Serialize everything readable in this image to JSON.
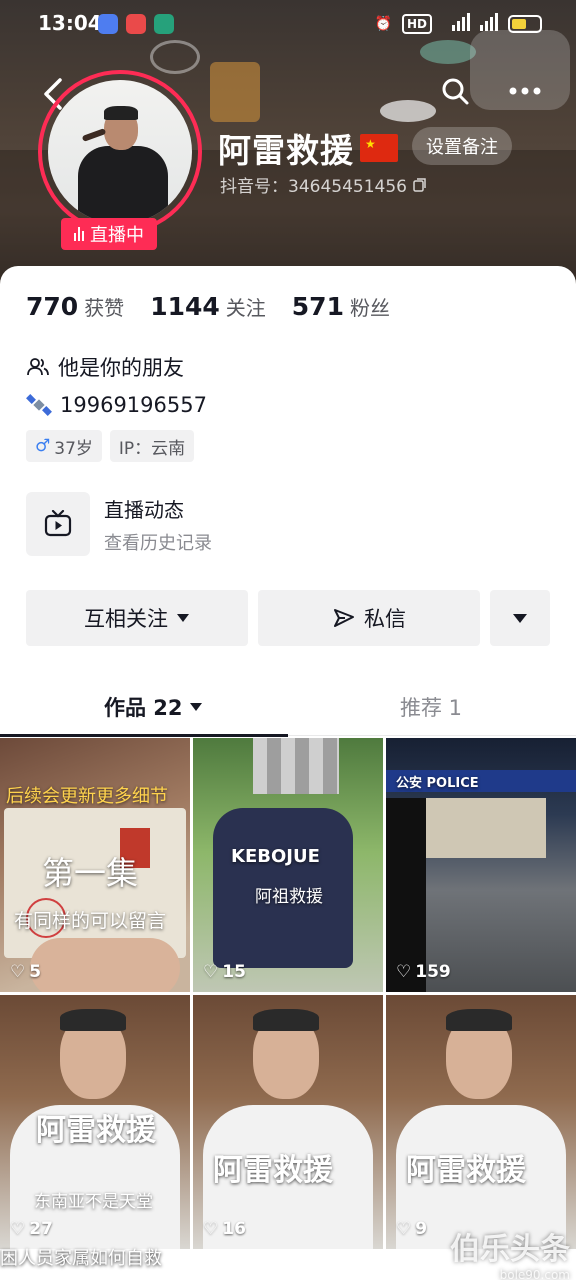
{
  "status_bar": {
    "time": "13:04",
    "hd": "HD",
    "network": "4G 5G"
  },
  "profile": {
    "name": "阿雷救援",
    "douyin_id": "抖音号：34645451456",
    "remark_button": "设置备注",
    "live_badge": "直播中"
  },
  "stats": [
    {
      "num": "770",
      "label": "获赞"
    },
    {
      "num": "1144",
      "label": "关注"
    },
    {
      "num": "571",
      "label": "粉丝"
    }
  ],
  "bio": {
    "friend": "他是你的朋友",
    "phone": "19969196557",
    "gender_age": "37岁",
    "ip": "IP：云南"
  },
  "live_history": {
    "title": "直播动态",
    "subtitle": "查看历史记录"
  },
  "actions": {
    "follow": "互相关注",
    "message": "私信"
  },
  "tabs": {
    "works": "作品 22",
    "recommend": "推荐 1"
  },
  "videos": [
    {
      "likes": "5",
      "top_text": "后续会更新更多细节",
      "big_text": "第一集",
      "mid_text": "有同样的可以留言"
    },
    {
      "likes": "15",
      "shirt_text": "KEBOJUE",
      "shirt_text2": "阿祖救援"
    },
    {
      "likes": "159",
      "sign": "公安  POLICE"
    },
    {
      "likes": "27",
      "title": "阿雷救援",
      "subtitle": "东南亚不是天堂"
    },
    {
      "likes": "16",
      "title": "阿雷救援"
    },
    {
      "likes": "9",
      "title": "阿雷救援"
    }
  ],
  "bottom_caption": "困人员家属如何自救",
  "watermark": {
    "text": "伯乐头条",
    "url": "bole90.com"
  },
  "colors": {
    "accent": "#fe2c55",
    "text": "#161823",
    "muted": "#8a8b91"
  }
}
